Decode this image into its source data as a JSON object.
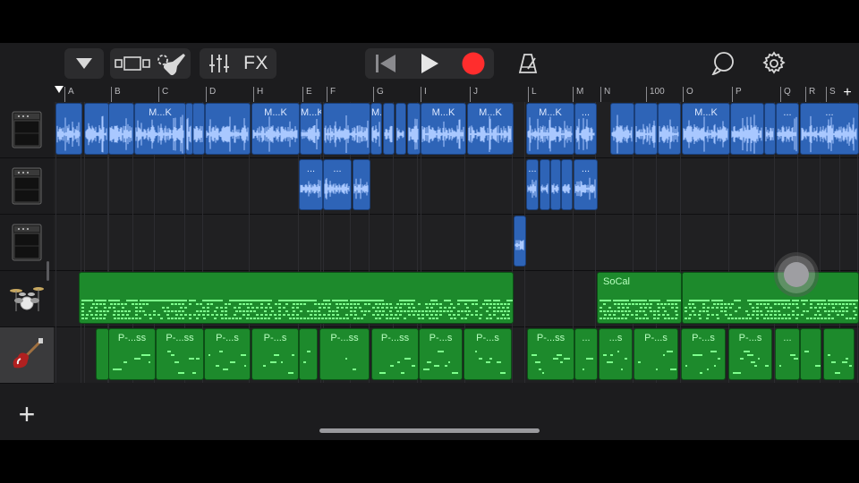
{
  "toolbar": {
    "fx_label": "FX",
    "icons": {
      "browser": "triangle-down-icon",
      "view": "tracks-view-icon",
      "instrument": "guitar-icon",
      "mixer": "mixer-sliders-icon",
      "rewind": "go-to-beginning-icon",
      "play": "play-icon",
      "record": "record-icon",
      "metronome": "metronome-icon",
      "loop": "loop-icon",
      "settings": "gear-icon"
    }
  },
  "ruler": {
    "markers": [
      "A",
      "B",
      "C",
      "D",
      "H",
      "E",
      "F",
      "G",
      "I",
      "J",
      "L",
      "M",
      "N",
      "100",
      "O",
      "P",
      "Q",
      "R",
      "S"
    ],
    "add_label": "+"
  },
  "tracks": [
    {
      "name": "amp-1",
      "type": "audio",
      "regions": [
        {
          "label": ""
        },
        {
          "label": ""
        },
        {
          "label": ""
        },
        {
          "label": "M...K"
        },
        {
          "label": ""
        },
        {
          "label": ""
        },
        {
          "label": ""
        },
        {
          "label": "M...K"
        },
        {
          "label": "M...K"
        },
        {
          "label": ""
        },
        {
          "label": "M...K"
        },
        {
          "label": ""
        },
        {
          "label": ""
        },
        {
          "label": ""
        },
        {
          "label": "M...K"
        },
        {
          "label": "M...K"
        },
        {
          "label": "M...K"
        },
        {
          "label": "..."
        },
        {
          "label": ""
        },
        {
          "label": ""
        },
        {
          "label": ""
        },
        {
          "label": "M...K"
        },
        {
          "label": ""
        },
        {
          "label": ""
        },
        {
          "label": "..."
        },
        {
          "label": "..."
        }
      ]
    },
    {
      "name": "amp-2",
      "type": "audio",
      "regions": [
        {
          "label": "..."
        },
        {
          "label": "..."
        },
        {
          "label": ""
        },
        {
          "label": "..."
        },
        {
          "label": ""
        },
        {
          "label": ""
        },
        {
          "label": ""
        },
        {
          "label": "..."
        }
      ]
    },
    {
      "name": "amp-3",
      "type": "audio",
      "regions": [
        {
          "label": ""
        }
      ]
    },
    {
      "name": "drums",
      "type": "midi",
      "regions": [
        {
          "label": ""
        },
        {
          "label": "SoCal"
        },
        {
          "label": ""
        }
      ]
    },
    {
      "name": "bass",
      "type": "midi",
      "regions": [
        {
          "label": ""
        },
        {
          "label": "P-...ss"
        },
        {
          "label": "P-...ss"
        },
        {
          "label": "P-...s"
        },
        {
          "label": "P-...s"
        },
        {
          "label": ""
        },
        {
          "label": "P-...ss"
        },
        {
          "label": "P-...ss"
        },
        {
          "label": "P-...s"
        },
        {
          "label": "P-...s"
        },
        {
          "label": "P-...ss"
        },
        {
          "label": "..."
        },
        {
          "label": "...s"
        },
        {
          "label": "P-...s"
        },
        {
          "label": "P-...s"
        },
        {
          "label": "P-...s"
        },
        {
          "label": "..."
        },
        {
          "label": ""
        },
        {
          "label": ""
        }
      ]
    }
  ],
  "add_track_label": "+",
  "colors": {
    "audio": "#2e64b7",
    "midi": "#1d8a2c",
    "record": "#ff2d2d"
  }
}
